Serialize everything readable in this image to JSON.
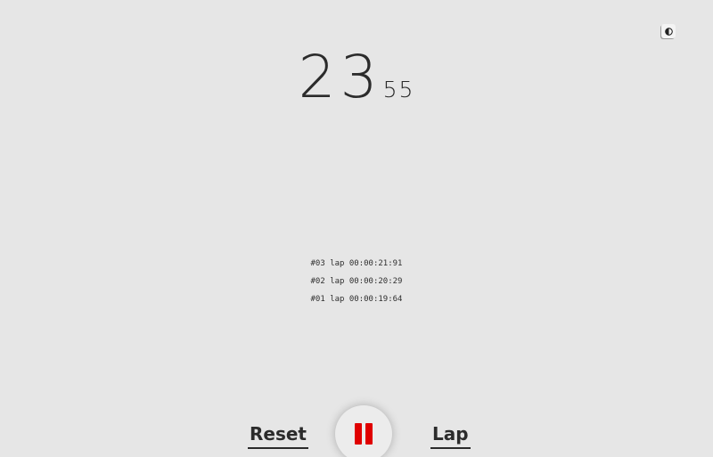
{
  "timer": {
    "seconds": "23",
    "centiseconds": "55"
  },
  "laps": [
    {
      "text": "#03 lap 00:00:21:91"
    },
    {
      "text": "#02 lap 00:00:20:29"
    },
    {
      "text": "#01 lap 00:00:19:64"
    }
  ],
  "controls": {
    "reset_label": "Reset",
    "lap_label": "Lap",
    "pause_icon": "pause-icon"
  },
  "theme_toggle": {
    "icon": "contrast-icon"
  },
  "colors": {
    "background": "#e6e6e6",
    "text": "#2b2b2b",
    "accent": "#e00000"
  }
}
